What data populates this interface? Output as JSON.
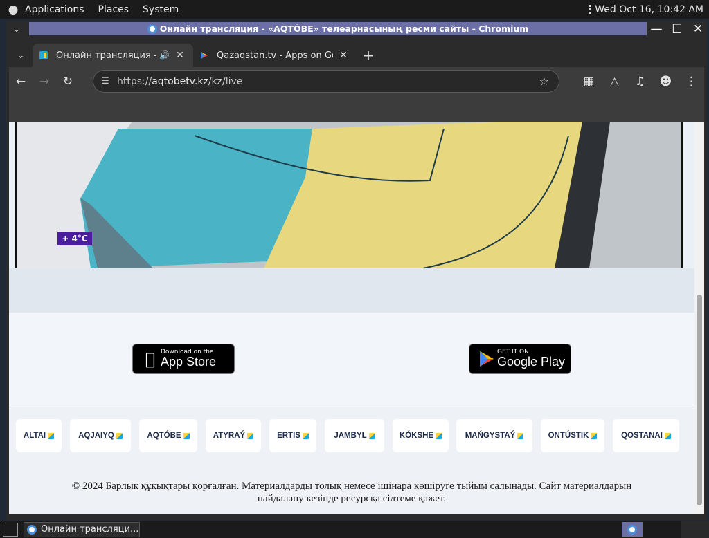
{
  "top_panel": {
    "menus": [
      "Applications",
      "Places",
      "System"
    ],
    "clock": "Wed Oct 16, 10:42 AM"
  },
  "window": {
    "title": "Онлайн трансляция - «AQTÓBE» телеарнасының ресми сайты - Chromium"
  },
  "tabs": [
    {
      "label": "Онлайн трансляция - «AQTÓBE»",
      "active": true
    },
    {
      "label": "Qazaqstan.tv - Apps on Google Play",
      "active": false
    }
  ],
  "omnibox": {
    "url_scheme": "https://",
    "url_host": "aqtobetv.kz",
    "url_path": "/kz/live"
  },
  "page": {
    "temperature": "+ 4°C",
    "app_store": {
      "small": "Download on the",
      "big": "App Store"
    },
    "google_play": {
      "small": "GET IT ON",
      "big": "Google Play"
    },
    "regions": [
      "ALTAI",
      "AQJAIYQ",
      "AQTÓBE",
      "ATYRAÝ",
      "ERTIS",
      "JAMBYL",
      "KÓKSHE",
      "MAŃGYSTAÝ",
      "ONTÚSTIK",
      "QOSTANAI"
    ],
    "copyright_line1": "© 2024 Барлық құқықтары қорғалған. Материалдарды толық немесе ішінара көшіруге тыйым салынады. Сайт материалдарын",
    "copyright_line2": "пайдалану кезінде ресурсқа сілтеме қажет."
  },
  "taskbar": {
    "task_label": "Онлайн трансляци..."
  },
  "colors": {
    "title_highlight": "#6b6fa6",
    "temp_badge": "#4b1ea0",
    "page_bg": "#eaf0f6"
  }
}
